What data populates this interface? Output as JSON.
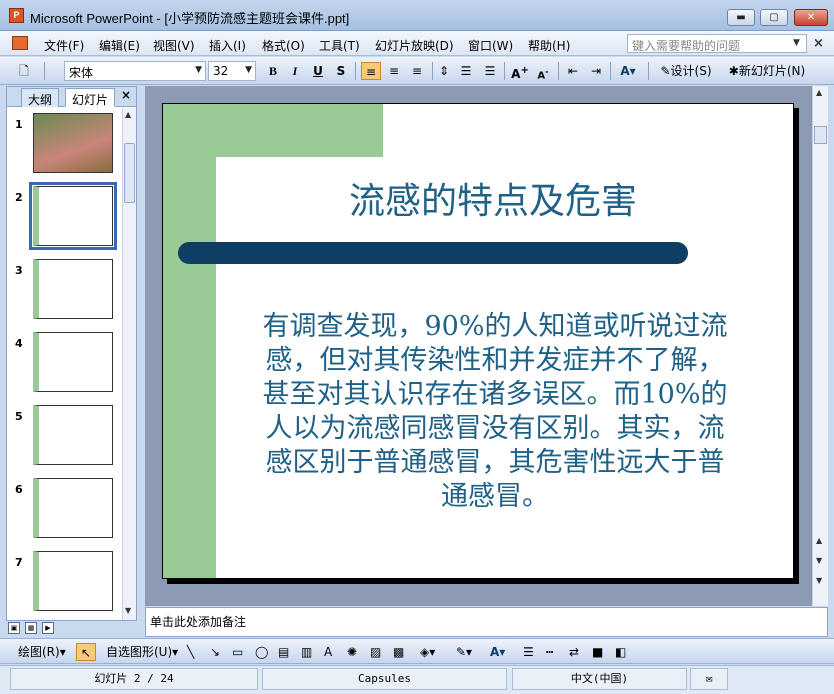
{
  "window": {
    "title": "Microsoft PowerPoint - [小学预防流感主题班会课件.ppt]",
    "app_icon": "powerpoint-icon",
    "minimize_label": "▬",
    "maximize_label": "▢",
    "close_label": "✕"
  },
  "menu": {
    "items": [
      "文件(F)",
      "编辑(E)",
      "视图(V)",
      "插入(I)",
      "格式(O)",
      "工具(T)",
      "幻灯片放映(D)",
      "窗口(W)",
      "帮助(H)"
    ],
    "help_placeholder": "键入需要帮助的问题",
    "close_x": "×"
  },
  "toolbar": {
    "font_name": "宋体",
    "font_size": "32",
    "bold": "B",
    "italic": "I",
    "underline": "U",
    "shadow": "S",
    "design_label": "设计(S)",
    "new_slide_label": "新幻灯片(N)"
  },
  "left_panel": {
    "tab_outline": "大纲",
    "tab_slides": "幻灯片",
    "close": "×",
    "slide_numbers": [
      "1",
      "2",
      "3",
      "4",
      "5",
      "6",
      "7"
    ],
    "selected": 2
  },
  "slide": {
    "title": "流感的特点及危害",
    "body": "有调查发现，90%的人知道或听说过流感，但对其传染性和并发症并不了解，甚至对其认识存在诸多误区。而10%的人以为流感同感冒没有区别。其实，流感区别于普通感冒，其危害性远大于普通感冒。"
  },
  "notes": {
    "placeholder": "单击此处添加备注"
  },
  "drawbar": {
    "draw_label": "绘图(R)",
    "autoshapes_label": "自选图形(U)"
  },
  "status": {
    "slide_info": "幻灯片 2 / 24",
    "template": "Capsules",
    "language": "中文(中国)"
  },
  "colors": {
    "title_color": "#1f6187",
    "accent_bar": "#0e3e63",
    "green": "#9acb96"
  }
}
